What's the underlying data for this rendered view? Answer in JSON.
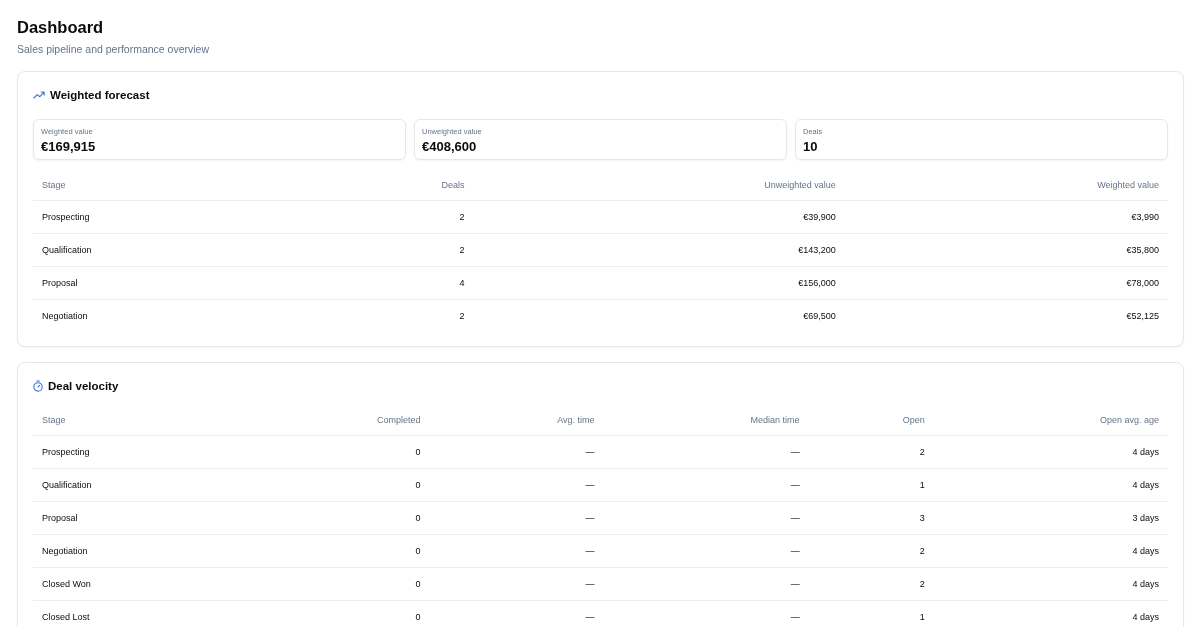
{
  "page": {
    "title": "Dashboard",
    "subtitle": "Sales pipeline and performance overview"
  },
  "sections": [
    {
      "title": "Weighted forecast",
      "stats": [
        {
          "label": "Weighted value",
          "value": "€169,915"
        },
        {
          "label": "Unweighted value",
          "value": "€408,600"
        },
        {
          "label": "Deals",
          "value": "10"
        }
      ],
      "table": {
        "columns": [
          "Stage",
          "Deals",
          "Unweighted value",
          "Weighted value"
        ],
        "rows": [
          [
            "Prospecting",
            "2",
            "€39,900",
            "€3,990"
          ],
          [
            "Qualification",
            "2",
            "€143,200",
            "€35,800"
          ],
          [
            "Proposal",
            "4",
            "€156,000",
            "€78,000"
          ],
          [
            "Negotiation",
            "2",
            "€69,500",
            "€52,125"
          ]
        ]
      }
    },
    {
      "title": "Deal velocity",
      "table": {
        "columns": [
          "Stage",
          "Completed",
          "Avg. time",
          "Median time",
          "Open",
          "Open avg. age"
        ],
        "rows": [
          [
            "Prospecting",
            "0",
            "—",
            "—",
            "2",
            "4 days"
          ],
          [
            "Qualification",
            "0",
            "—",
            "—",
            "1",
            "4 days"
          ],
          [
            "Proposal",
            "0",
            "—",
            "—",
            "3",
            "3 days"
          ],
          [
            "Negotiation",
            "0",
            "—",
            "—",
            "2",
            "4 days"
          ],
          [
            "Closed Won",
            "0",
            "—",
            "—",
            "2",
            "4 days"
          ],
          [
            "Closed Lost",
            "0",
            "—",
            "—",
            "1",
            "4 days"
          ]
        ]
      }
    }
  ]
}
